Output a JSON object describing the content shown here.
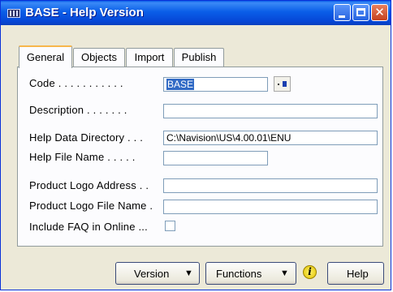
{
  "window": {
    "title": "BASE - Help Version"
  },
  "tabs": [
    {
      "label": "General",
      "active": true
    },
    {
      "label": "Objects",
      "active": false
    },
    {
      "label": "Import",
      "active": false
    },
    {
      "label": "Publish",
      "active": false
    }
  ],
  "fields": {
    "code": {
      "label": "Code . . . . . . . . . . .",
      "value": "BASE"
    },
    "description": {
      "label": "Description . . . . . . .",
      "value": ""
    },
    "help_data_directory": {
      "label": "Help Data Directory . . .",
      "value": "C:\\Navision\\US\\4.00.01\\ENU"
    },
    "help_file_name": {
      "label": "Help File Name  . . . . .",
      "value": ""
    },
    "product_logo_address": {
      "label": "Product Logo Address . .",
      "value": ""
    },
    "product_logo_file_name": {
      "label": "Product Logo File Name  .",
      "value": ""
    },
    "include_faq": {
      "label": "Include FAQ in Online ...",
      "checked": false
    }
  },
  "buttons": {
    "version": "Version",
    "functions": "Functions",
    "help": "Help",
    "info_glyph": "i"
  },
  "icons": {
    "app": "window-app-icon",
    "minimize": "minimize-icon",
    "maximize": "maximize-icon",
    "close": "close-icon",
    "lookup": "lookup-icon",
    "dropdown": "dropdown-arrow-icon",
    "info": "info-icon"
  },
  "colors": {
    "titlebar": "#0a5ee8",
    "face": "#ece9d8",
    "close_button": "#d4502b",
    "selection": "#316ac5",
    "active_tab_highlight": "#f7b64b"
  }
}
